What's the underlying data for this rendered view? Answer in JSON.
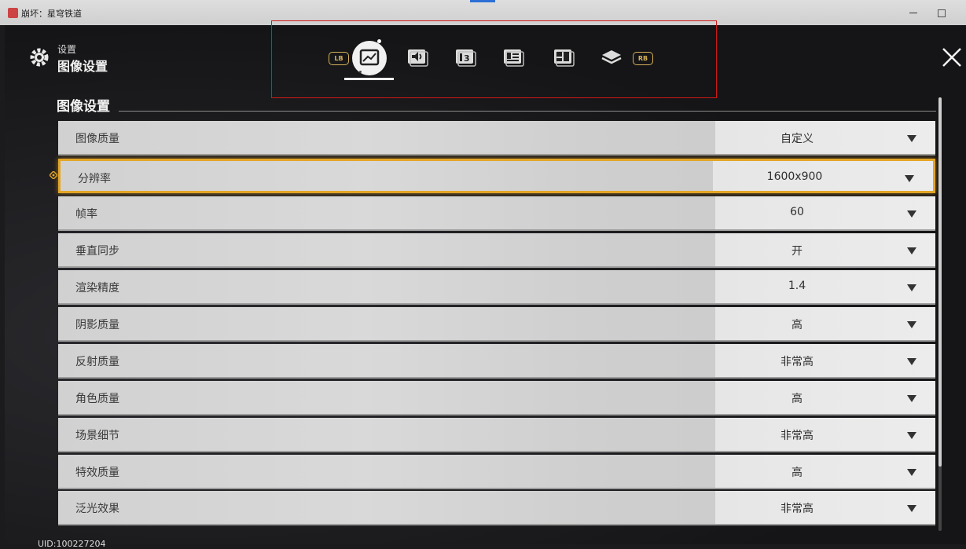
{
  "window": {
    "title": "崩坏：星穹铁道"
  },
  "header": {
    "subtitle": "设置",
    "title": "图像设置"
  },
  "tabs": {
    "lb_label": "LB",
    "rb_label": "RB",
    "items": [
      {
        "icon": "image-settings-icon",
        "active": true
      },
      {
        "icon": "audio-icon",
        "active": false
      },
      {
        "icon": "language-icon",
        "active": false
      },
      {
        "icon": "account-card-icon",
        "active": false
      },
      {
        "icon": "controls-layout-icon",
        "active": false
      },
      {
        "icon": "layers-icon",
        "active": false
      }
    ]
  },
  "section": {
    "title": "图像设置"
  },
  "settings": [
    {
      "label": "图像质量",
      "value": "自定义"
    },
    {
      "label": "分辨率",
      "value": "1600x900"
    },
    {
      "label": "帧率",
      "value": "60"
    },
    {
      "label": "垂直同步",
      "value": "开"
    },
    {
      "label": "渲染精度",
      "value": "1.4"
    },
    {
      "label": "阴影质量",
      "value": "高"
    },
    {
      "label": "反射质量",
      "value": "非常高"
    },
    {
      "label": "角色质量",
      "value": "高"
    },
    {
      "label": "场景细节",
      "value": "非常高"
    },
    {
      "label": "特效质量",
      "value": "高"
    },
    {
      "label": "泛光效果",
      "value": "非常高"
    }
  ],
  "footer": {
    "uid": "UID:100227204"
  },
  "colors": {
    "accent": "#e3a527",
    "pill": "#d4b05a",
    "highlight_box": "#d01818"
  }
}
